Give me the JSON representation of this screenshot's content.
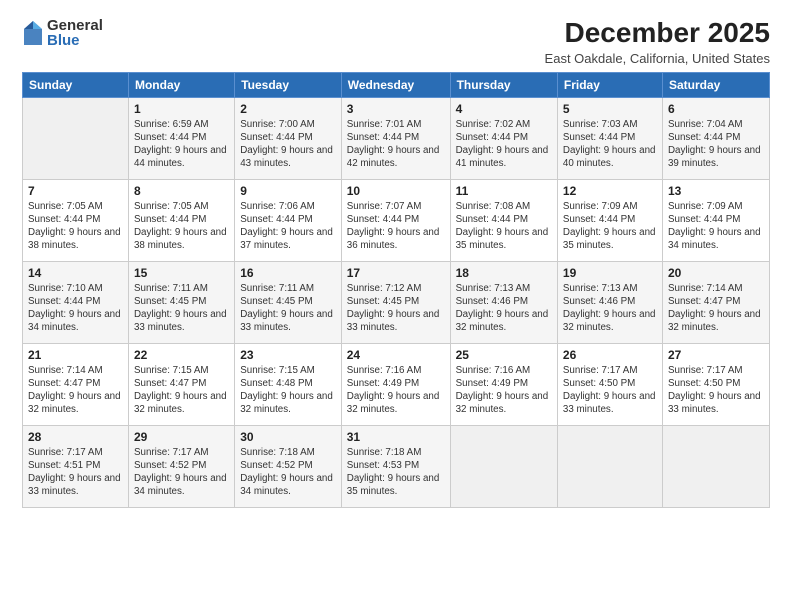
{
  "logo": {
    "general": "General",
    "blue": "Blue"
  },
  "title": "December 2025",
  "subtitle": "East Oakdale, California, United States",
  "weekdays": [
    "Sunday",
    "Monday",
    "Tuesday",
    "Wednesday",
    "Thursday",
    "Friday",
    "Saturday"
  ],
  "weeks": [
    [
      {
        "day": "",
        "info": ""
      },
      {
        "day": "1",
        "info": "Sunrise: 6:59 AM\nSunset: 4:44 PM\nDaylight: 9 hours\nand 44 minutes."
      },
      {
        "day": "2",
        "info": "Sunrise: 7:00 AM\nSunset: 4:44 PM\nDaylight: 9 hours\nand 43 minutes."
      },
      {
        "day": "3",
        "info": "Sunrise: 7:01 AM\nSunset: 4:44 PM\nDaylight: 9 hours\nand 42 minutes."
      },
      {
        "day": "4",
        "info": "Sunrise: 7:02 AM\nSunset: 4:44 PM\nDaylight: 9 hours\nand 41 minutes."
      },
      {
        "day": "5",
        "info": "Sunrise: 7:03 AM\nSunset: 4:44 PM\nDaylight: 9 hours\nand 40 minutes."
      },
      {
        "day": "6",
        "info": "Sunrise: 7:04 AM\nSunset: 4:44 PM\nDaylight: 9 hours\nand 39 minutes."
      }
    ],
    [
      {
        "day": "7",
        "info": "Sunrise: 7:05 AM\nSunset: 4:44 PM\nDaylight: 9 hours\nand 38 minutes."
      },
      {
        "day": "8",
        "info": "Sunrise: 7:05 AM\nSunset: 4:44 PM\nDaylight: 9 hours\nand 38 minutes."
      },
      {
        "day": "9",
        "info": "Sunrise: 7:06 AM\nSunset: 4:44 PM\nDaylight: 9 hours\nand 37 minutes."
      },
      {
        "day": "10",
        "info": "Sunrise: 7:07 AM\nSunset: 4:44 PM\nDaylight: 9 hours\nand 36 minutes."
      },
      {
        "day": "11",
        "info": "Sunrise: 7:08 AM\nSunset: 4:44 PM\nDaylight: 9 hours\nand 35 minutes."
      },
      {
        "day": "12",
        "info": "Sunrise: 7:09 AM\nSunset: 4:44 PM\nDaylight: 9 hours\nand 35 minutes."
      },
      {
        "day": "13",
        "info": "Sunrise: 7:09 AM\nSunset: 4:44 PM\nDaylight: 9 hours\nand 34 minutes."
      }
    ],
    [
      {
        "day": "14",
        "info": "Sunrise: 7:10 AM\nSunset: 4:44 PM\nDaylight: 9 hours\nand 34 minutes."
      },
      {
        "day": "15",
        "info": "Sunrise: 7:11 AM\nSunset: 4:45 PM\nDaylight: 9 hours\nand 33 minutes."
      },
      {
        "day": "16",
        "info": "Sunrise: 7:11 AM\nSunset: 4:45 PM\nDaylight: 9 hours\nand 33 minutes."
      },
      {
        "day": "17",
        "info": "Sunrise: 7:12 AM\nSunset: 4:45 PM\nDaylight: 9 hours\nand 33 minutes."
      },
      {
        "day": "18",
        "info": "Sunrise: 7:13 AM\nSunset: 4:46 PM\nDaylight: 9 hours\nand 32 minutes."
      },
      {
        "day": "19",
        "info": "Sunrise: 7:13 AM\nSunset: 4:46 PM\nDaylight: 9 hours\nand 32 minutes."
      },
      {
        "day": "20",
        "info": "Sunrise: 7:14 AM\nSunset: 4:47 PM\nDaylight: 9 hours\nand 32 minutes."
      }
    ],
    [
      {
        "day": "21",
        "info": "Sunrise: 7:14 AM\nSunset: 4:47 PM\nDaylight: 9 hours\nand 32 minutes."
      },
      {
        "day": "22",
        "info": "Sunrise: 7:15 AM\nSunset: 4:47 PM\nDaylight: 9 hours\nand 32 minutes."
      },
      {
        "day": "23",
        "info": "Sunrise: 7:15 AM\nSunset: 4:48 PM\nDaylight: 9 hours\nand 32 minutes."
      },
      {
        "day": "24",
        "info": "Sunrise: 7:16 AM\nSunset: 4:49 PM\nDaylight: 9 hours\nand 32 minutes."
      },
      {
        "day": "25",
        "info": "Sunrise: 7:16 AM\nSunset: 4:49 PM\nDaylight: 9 hours\nand 32 minutes."
      },
      {
        "day": "26",
        "info": "Sunrise: 7:17 AM\nSunset: 4:50 PM\nDaylight: 9 hours\nand 33 minutes."
      },
      {
        "day": "27",
        "info": "Sunrise: 7:17 AM\nSunset: 4:50 PM\nDaylight: 9 hours\nand 33 minutes."
      }
    ],
    [
      {
        "day": "28",
        "info": "Sunrise: 7:17 AM\nSunset: 4:51 PM\nDaylight: 9 hours\nand 33 minutes."
      },
      {
        "day": "29",
        "info": "Sunrise: 7:17 AM\nSunset: 4:52 PM\nDaylight: 9 hours\nand 34 minutes."
      },
      {
        "day": "30",
        "info": "Sunrise: 7:18 AM\nSunset: 4:52 PM\nDaylight: 9 hours\nand 34 minutes."
      },
      {
        "day": "31",
        "info": "Sunrise: 7:18 AM\nSunset: 4:53 PM\nDaylight: 9 hours\nand 35 minutes."
      },
      {
        "day": "",
        "info": ""
      },
      {
        "day": "",
        "info": ""
      },
      {
        "day": "",
        "info": ""
      }
    ]
  ]
}
